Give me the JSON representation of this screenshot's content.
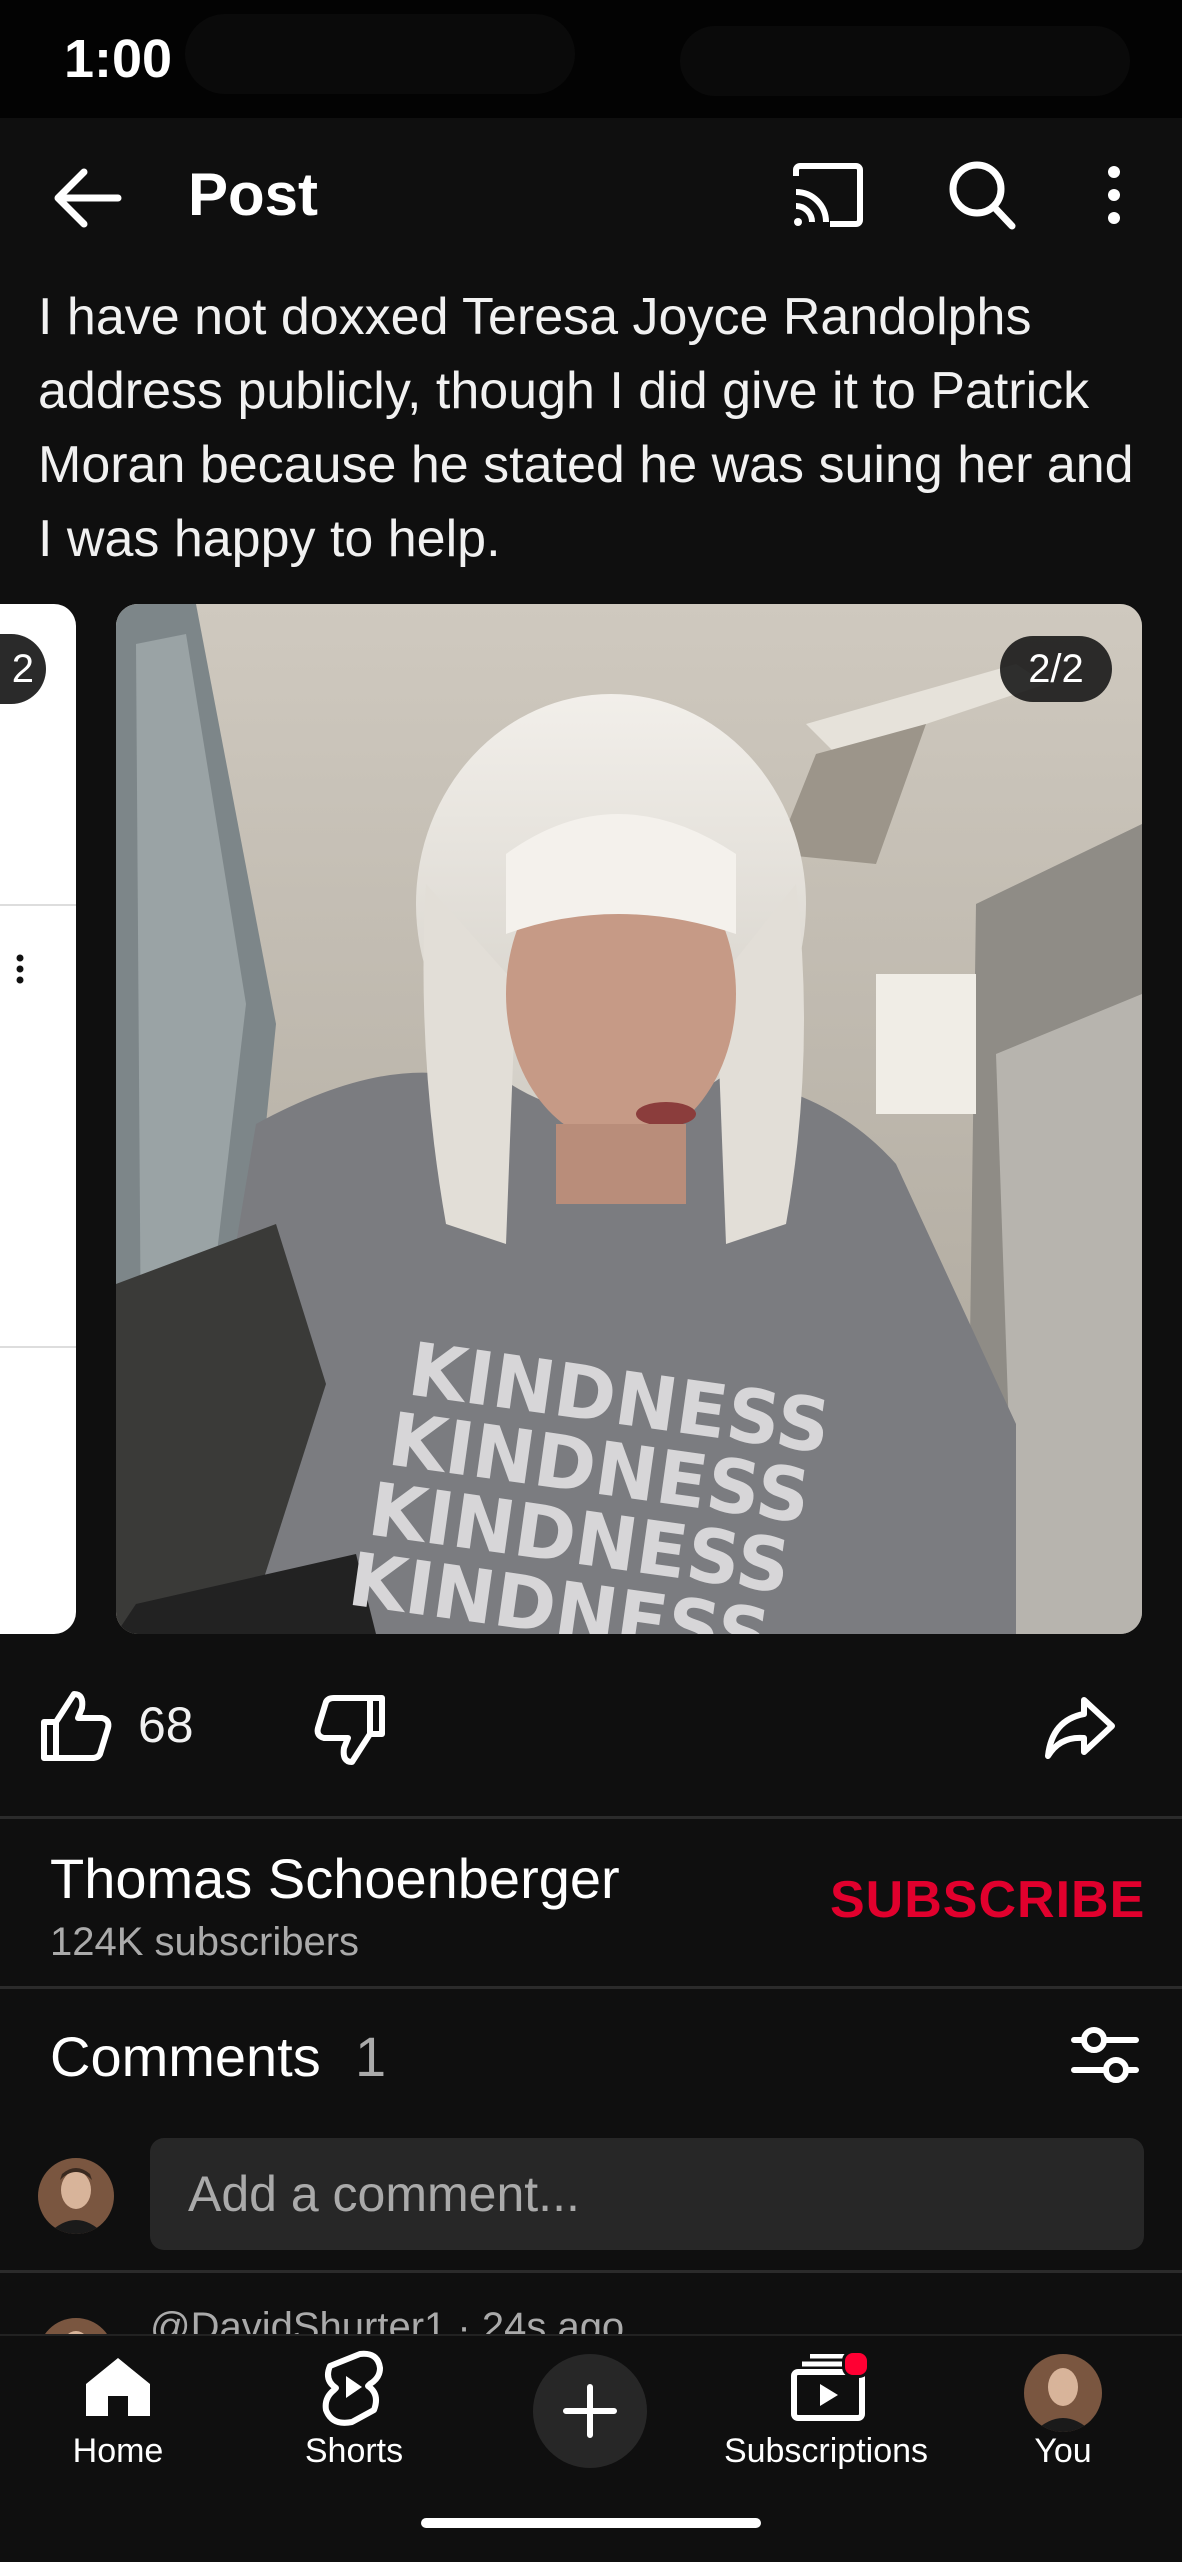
{
  "status_bar": {
    "time": "1:00"
  },
  "app_bar": {
    "title": "Post",
    "icons": [
      "back-arrow-icon",
      "cast-icon",
      "search-icon",
      "more-vert-icon"
    ]
  },
  "post": {
    "text": "I have not doxxed Teresa Joyce Randolphs address publicly, though I did give it to Patrick Moran because he stated he was suing her and I was happy to help.",
    "carousel": {
      "prev_counter": "2",
      "counter": "2/2"
    },
    "actions": {
      "like_count": "68",
      "icons": [
        "thumb-up-icon",
        "thumb-down-icon",
        "share-icon"
      ]
    }
  },
  "channel": {
    "name": "Thomas Schoenberger",
    "subscribers": "124K subscribers",
    "subscribe_label": "SUBSCRIBE",
    "subscribe_color": "#e1002d"
  },
  "comments": {
    "title": "Comments",
    "count": "1",
    "input_placeholder": "Add a comment...",
    "first_comment_header": "@DavidShurter1 · 24s ago"
  },
  "bottom_nav": {
    "items": [
      {
        "label": "Home",
        "icon": "home-icon"
      },
      {
        "label": "Shorts",
        "icon": "shorts-icon"
      },
      {
        "label": "",
        "icon": "plus-icon"
      },
      {
        "label": "Subscriptions",
        "icon": "subscriptions-icon"
      },
      {
        "label": "You",
        "icon": "avatar"
      }
    ],
    "badge_color": "#ff0033"
  }
}
